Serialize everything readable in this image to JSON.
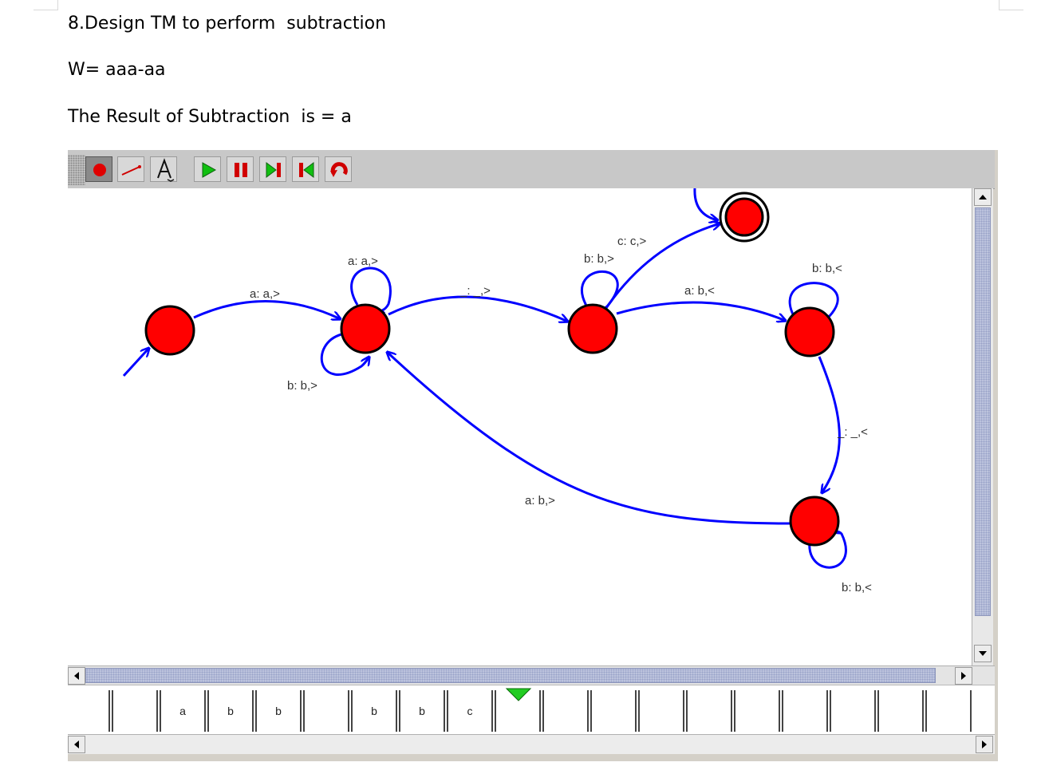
{
  "document": {
    "title": "8.Design TM to perform  subtraction",
    "input_word": "W= aaa-aa",
    "result": "The Result of Subtraction  is = a"
  },
  "toolbar": {
    "tools": [
      {
        "name": "state-tool",
        "icon": "red-dot-icon",
        "selected": true
      },
      {
        "name": "transition-tool",
        "icon": "arrow-line-icon"
      },
      {
        "name": "label-tool",
        "icon": "letter-a-icon"
      },
      {
        "name": "run",
        "icon": "play-icon"
      },
      {
        "name": "pause",
        "icon": "pause-icon"
      },
      {
        "name": "step-forward",
        "icon": "step-forward-icon"
      },
      {
        "name": "step-back",
        "icon": "step-back-icon"
      },
      {
        "name": "reset",
        "icon": "reset-icon"
      }
    ]
  },
  "diagram": {
    "state_color": "#ff0000",
    "edge_color": "#0000ff",
    "states": [
      {
        "id": "q0",
        "initial": true
      },
      {
        "id": "q1"
      },
      {
        "id": "q2"
      },
      {
        "id": "q3"
      },
      {
        "id": "q4"
      },
      {
        "id": "qf",
        "accepting": true
      }
    ],
    "transitions": [
      {
        "from": "q0",
        "to": "q1",
        "label": "a: a,>"
      },
      {
        "from": "q1",
        "to": "q1",
        "label": "a: a,>"
      },
      {
        "from": "q1",
        "to": "q1",
        "label": "b: b,>"
      },
      {
        "from": "q1",
        "to": "q2",
        "label": "_: _,>"
      },
      {
        "from": "q2",
        "to": "q2",
        "label": "b: b,>"
      },
      {
        "from": "q2",
        "to": "qf",
        "label": "c: c,>"
      },
      {
        "from": "q2",
        "to": "q3",
        "label": "a: b,<"
      },
      {
        "from": "q3",
        "to": "q3",
        "label": "b: b,<"
      },
      {
        "from": "q3",
        "to": "q4",
        "label": "_: _,<"
      },
      {
        "from": "q4",
        "to": "q4",
        "label": "b: b,<"
      },
      {
        "from": "q4",
        "to": "q1",
        "label": "a: b,>"
      }
    ]
  },
  "tape": {
    "cells": [
      "",
      "",
      "a",
      "b",
      "b",
      "",
      "b",
      "b",
      "c",
      "",
      "",
      "",
      "",
      "",
      "",
      "",
      "",
      "",
      ""
    ],
    "head_index": 9,
    "head_color": "#22cc22"
  }
}
